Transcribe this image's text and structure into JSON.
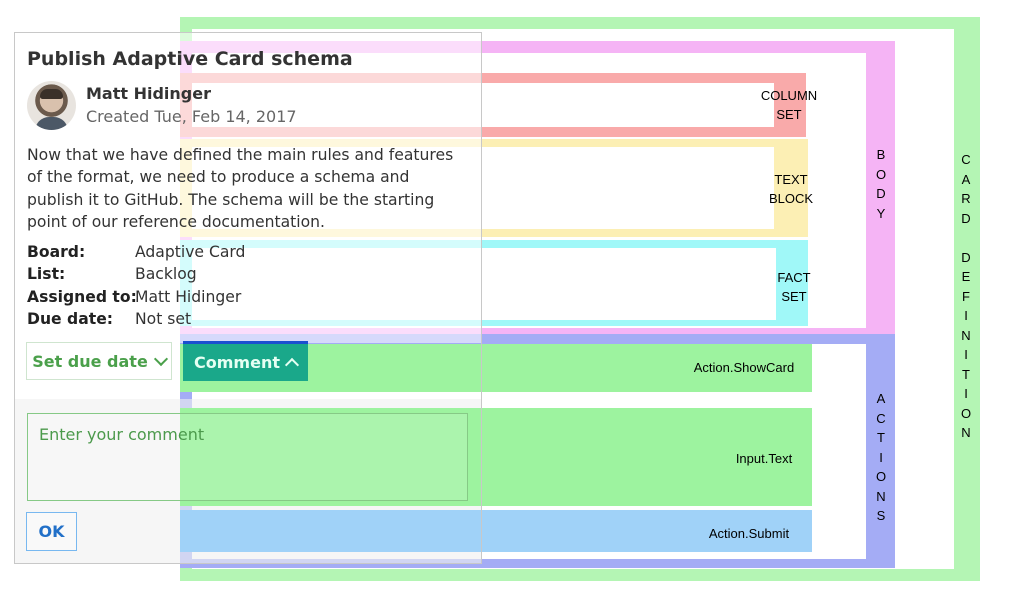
{
  "card": {
    "title": "Publish Adaptive Card schema",
    "author": "Matt Hidinger",
    "created": "Created Tue, Feb 14, 2017",
    "description": "Now that we have defined the main rules and features of the format, we need to produce a schema and publish it to GitHub. The schema will be the starting point of our reference documentation.",
    "facts": [
      {
        "key": "Board:",
        "value": "Adaptive Card"
      },
      {
        "key": "List:",
        "value": "Backlog"
      },
      {
        "key": "Assigned to:",
        "value": "Matt Hidinger"
      },
      {
        "key": "Due date:",
        "value": "Not set"
      }
    ],
    "actions": {
      "set_due_date": "Set due date",
      "comment": "Comment"
    },
    "input": {
      "placeholder": "Enter your comment"
    },
    "submit": "OK"
  },
  "annotations": {
    "column_set": "COLUMN\nSET",
    "text_block": "TEXT\nBLOCK",
    "fact_set": "FACT\nSET",
    "show_card": "Action.ShowCard",
    "input_text": "Input.Text",
    "submit": "Action.Submit",
    "body": "BODY",
    "actions": "ACTIONS",
    "card_definition": "CARD DEFINITION"
  },
  "colors": {
    "card_frame": "#b4f5b4",
    "body_frame": "#f5b4f5",
    "actions_frame": "#a4acf5",
    "column_set": "#f9aaaa",
    "text_block": "#fcefb4",
    "fact_set": "#a0f8f8",
    "show_card": "#9df39f",
    "input_text": "#9df39f",
    "submit": "#a0d2f8",
    "comment_button": "#1aa88a"
  },
  "icons": {
    "set_due_date": "chevron-down-icon",
    "comment": "chevron-up-icon",
    "avatar": "avatar-photo"
  }
}
